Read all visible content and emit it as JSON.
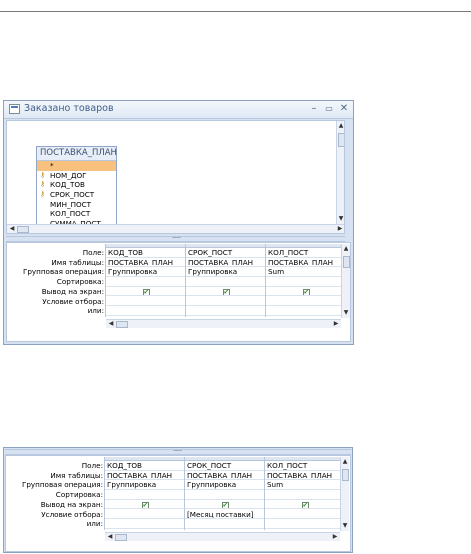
{
  "window": {
    "title": "Заказано товаров",
    "controls": {
      "minimize": "–",
      "maximize": "▭",
      "close": "✕"
    }
  },
  "table_box": {
    "title": "ПОСТАВКА_ПЛАН",
    "fields": [
      {
        "name": "*",
        "key": false,
        "selected": true
      },
      {
        "name": "НОМ_ДОГ",
        "key": true,
        "selected": false
      },
      {
        "name": "КОД_ТОВ",
        "key": true,
        "selected": false
      },
      {
        "name": "СРОК_ПОСТ",
        "key": true,
        "selected": false
      },
      {
        "name": "МИН_ПОСТ",
        "key": false,
        "selected": false
      },
      {
        "name": "КОЛ_ПОСТ",
        "key": false,
        "selected": false
      },
      {
        "name": "СУММА_ПОСТ",
        "key": false,
        "selected": false
      }
    ]
  },
  "row_labels": [
    "Поле:",
    "Имя таблицы:",
    "Групповая операция:",
    "Сортировка:",
    "Вывод на экран:",
    "Условие отбора:",
    "или:"
  ],
  "grid1": {
    "columns": [
      {
        "field": "КОД_ТОВ",
        "table": "ПОСТАВКА_ПЛАН",
        "group": "Группировка",
        "sort": "",
        "show": true,
        "criteria": "",
        "or": ""
      },
      {
        "field": "СРОК_ПОСТ",
        "table": "ПОСТАВКА_ПЛАН",
        "group": "Группировка",
        "sort": "",
        "show": true,
        "criteria": "",
        "or": ""
      },
      {
        "field": "КОЛ_ПОСТ",
        "table": "ПОСТАВКА_ПЛАН",
        "group": "Sum",
        "sort": "",
        "show": true,
        "criteria": "",
        "or": ""
      }
    ]
  },
  "grid2": {
    "columns": [
      {
        "field": "КОД_ТОВ",
        "table": "ПОСТАВКА_ПЛАН",
        "group": "Группировка",
        "sort": "",
        "show": true,
        "criteria": "",
        "or": ""
      },
      {
        "field": "СРОК_ПОСТ",
        "table": "ПОСТАВКА_ПЛАН",
        "group": "Группировка",
        "sort": "",
        "show": true,
        "criteria": "[Месяц поставки]",
        "or": ""
      },
      {
        "field": "КОЛ_ПОСТ",
        "table": "ПОСТАВКА_ПЛАН",
        "group": "Sum",
        "sort": "",
        "show": true,
        "criteria": "",
        "or": ""
      }
    ]
  },
  "checkbox_glyph": "✔",
  "colors": {
    "accent": "#3f5d88",
    "selected_field": "#f8c27e",
    "frame": "#d6e2f2"
  }
}
